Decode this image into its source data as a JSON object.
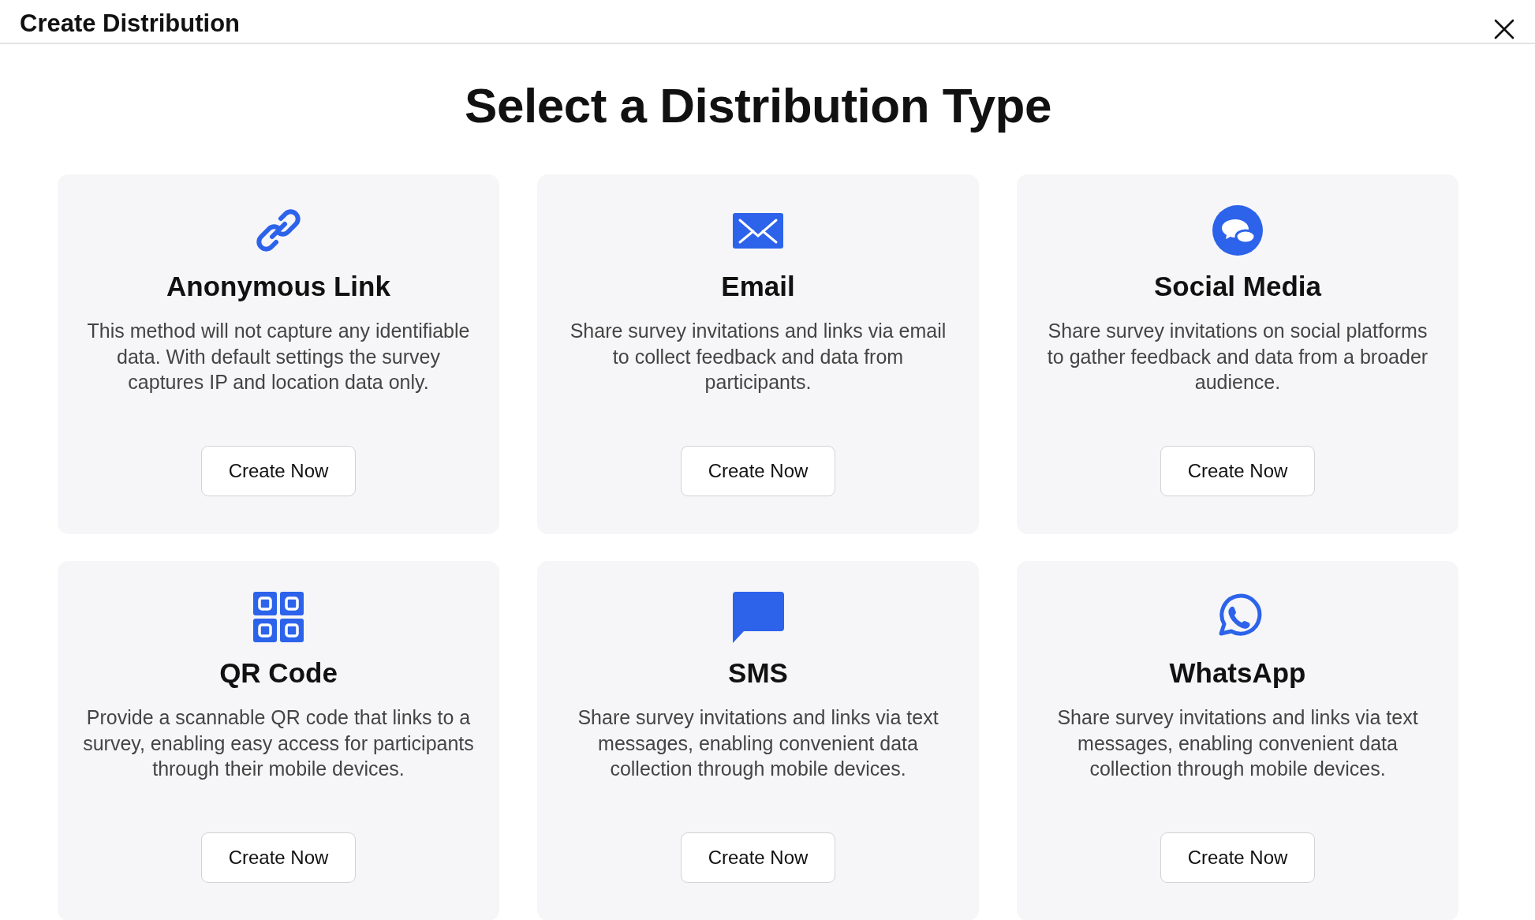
{
  "header": {
    "title": "Create Distribution"
  },
  "heading": "Select a Distribution Type",
  "cards": [
    {
      "kind": "link",
      "title": "Anonymous Link",
      "description": "This method will not capture any identifiable data. With default settings the survey captures IP and location data only.",
      "button": "Create Now"
    },
    {
      "kind": "email",
      "title": "Email",
      "description": "Share survey invitations and links via email to collect feedback and data from participants.",
      "button": "Create Now"
    },
    {
      "kind": "social",
      "title": "Social Media",
      "description": "Share survey invitations on social platforms to gather feedback and data from a broader audience.",
      "button": "Create Now"
    },
    {
      "kind": "qr",
      "title": "QR Code",
      "description": "Provide a scannable QR code that links to a survey, enabling easy access for participants through their mobile devices.",
      "button": "Create Now"
    },
    {
      "kind": "sms",
      "title": "SMS",
      "description": "Share survey invitations and links via text messages, enabling convenient data collection through mobile devices.",
      "button": "Create Now"
    },
    {
      "kind": "whatsapp",
      "title": "WhatsApp",
      "description": "Share survey invitations and links via text messages, enabling convenient data collection through mobile devices.",
      "button": "Create Now"
    }
  ]
}
